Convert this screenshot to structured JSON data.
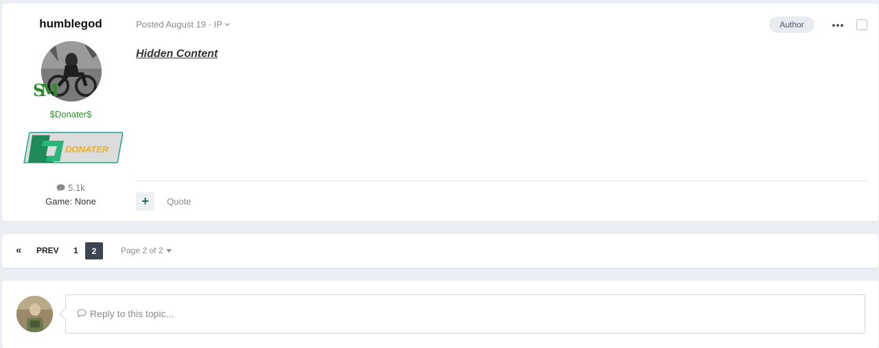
{
  "post": {
    "author": {
      "name": "humblegod",
      "group": "$Donater$",
      "badge_text": "DONATER",
      "post_count": "5.1k",
      "game": "Game: None"
    },
    "meta": "Posted August 19 · IP",
    "author_badge": "Author",
    "content": "Hidden Content",
    "quote_label": "Quote"
  },
  "pagination": {
    "first_label": "«",
    "prev_label": "PREV",
    "page_1": "1",
    "page_2": "2",
    "jump_label": "Page 2 of 2"
  },
  "reply": {
    "placeholder": "Reply to this topic..."
  }
}
